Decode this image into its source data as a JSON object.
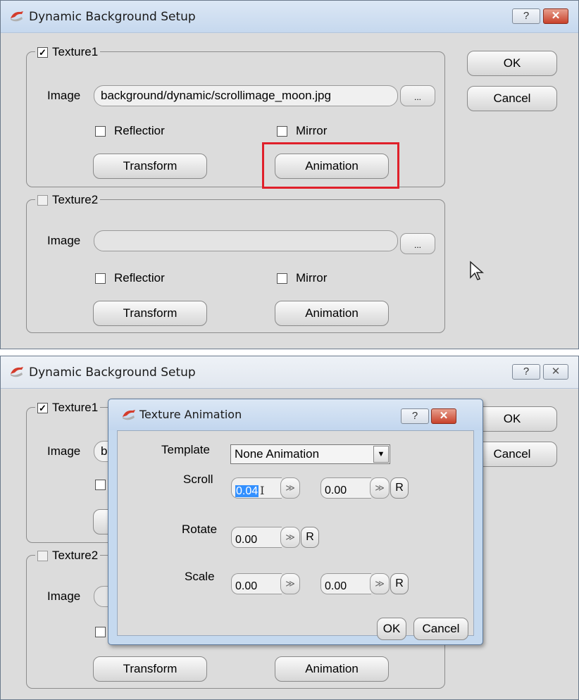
{
  "top_window": {
    "title": "Dynamic Background Setup",
    "help_label": "?",
    "close_label": "✕",
    "ok_label": "OK",
    "cancel_label": "Cancel",
    "texture1": {
      "title": "Texture1",
      "checked": true,
      "image_label": "Image",
      "image_value": "background/dynamic/scrollimage_moon.jpg",
      "browse_label": "...",
      "reflection_label": "Reflectior",
      "mirror_label": "Mirror",
      "transform_label": "Transform",
      "animation_label": "Animation"
    },
    "texture2": {
      "title": "Texture2",
      "checked": false,
      "image_label": "Image",
      "image_value": "",
      "browse_label": "...",
      "reflection_label": "Reflectior",
      "mirror_label": "Mirror",
      "transform_label": "Transform",
      "animation_label": "Animation"
    }
  },
  "bottom_window": {
    "title": "Dynamic Background Setup",
    "help_label": "?",
    "close_label": "✕",
    "ok_label": "OK",
    "cancel_label": "Cancel",
    "texture1_title": "Texture1",
    "texture2_title": "Texture2",
    "image_label": "Image",
    "image_value_partial": "ba",
    "transform_partial": "Transform",
    "animation_partial": "Animation"
  },
  "animation_dialog": {
    "title": "Texture Animation",
    "help_label": "?",
    "close_label": "✕",
    "template_label": "Template",
    "template_value": "None Animation",
    "scroll_label": "Scroll",
    "scroll_x": "0.04",
    "scroll_y": "0.00",
    "rotate_label": "Rotate",
    "rotate_value": "0.00",
    "scale_label": "Scale",
    "scale_x": "0.00",
    "scale_y": "0.00",
    "reset_label": "R",
    "ok_label": "OK",
    "cancel_label": "Cancel"
  },
  "colors": {
    "highlight": "#e0202a",
    "selection": "#3390ff"
  },
  "icons": {
    "app": "app-logo-icon",
    "spin": "spin-chevron-icon",
    "cursor": "mouse-pointer-icon"
  }
}
